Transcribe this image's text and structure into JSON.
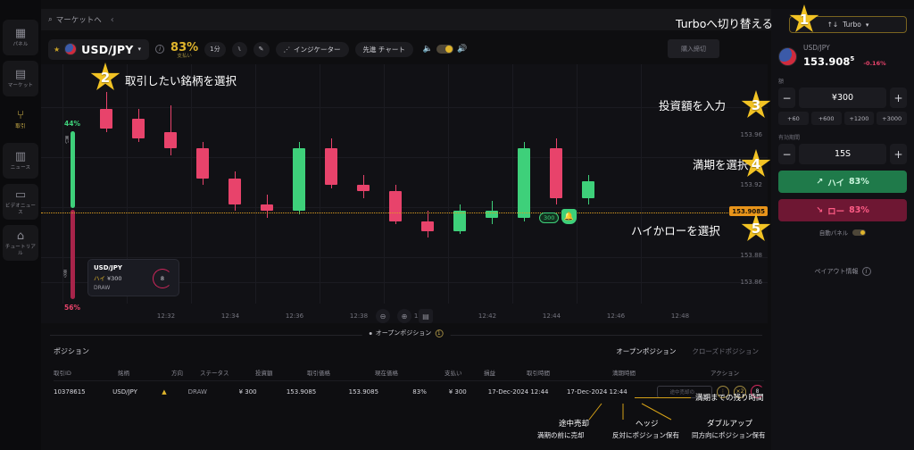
{
  "sidebar": {
    "items": [
      {
        "label": "パネル",
        "icon": "grid-icon",
        "active": false
      },
      {
        "label": "マーケット",
        "icon": "calendar-icon",
        "active": false
      },
      {
        "label": "取引",
        "icon": "trade-icon",
        "active": true
      },
      {
        "label": "ニュース",
        "icon": "news-icon",
        "active": false
      },
      {
        "label": "ビデオニュース",
        "icon": "video-icon",
        "active": false
      },
      {
        "label": "チュートリアル",
        "icon": "graduation-icon",
        "active": false
      }
    ]
  },
  "topbar": {
    "search_label": "マーケットへ",
    "search_icon": "search-icon",
    "back_icon": "chevron-left-icon"
  },
  "instrument_toolbar": {
    "star_icon": "star-icon",
    "flag_icon": "us-flag-icon",
    "name": "USD/JPY",
    "caret_icon": "chevron-down-icon",
    "info_icon": "info-icon",
    "payout_value": "83%",
    "payout_label": "支払い",
    "timeframe": "1分",
    "chart_type_icon": "candles-icon",
    "draw_icon": "pencil-icon",
    "indicators_label": "インジケーター",
    "indicators_icon": "indicator-icon",
    "advanced_chart_label": "先進 チャート",
    "sound_low_icon": "volume-low-icon",
    "sound_high_icon": "volume-high-icon",
    "buy_deadline_label": "購入締切"
  },
  "chart_data": {
    "type": "candlestick",
    "title": "USD/JPY",
    "timeframe": "1分",
    "xlabel": "",
    "ylabel": "",
    "ylim": [
      153.84,
      153.985
    ],
    "price_ticks": [
      "153.96",
      "153.92",
      "153.88",
      "153.86"
    ],
    "time_ticks": [
      "12:32",
      "12:34",
      "12:36",
      "12:38",
      "12:40",
      "12:42",
      "12:44",
      "12:46",
      "12:48"
    ],
    "current_price": "153.9085",
    "strike_price": "153.9085",
    "sentiment": {
      "up_pct": "44%",
      "down_pct": "56%",
      "up_label": "買い",
      "down_label": "売り"
    },
    "candles": [
      {
        "t": "12:31",
        "o": 153.958,
        "h": 153.968,
        "l": 153.944,
        "c": 153.946,
        "dir": "down"
      },
      {
        "t": "12:32",
        "o": 153.952,
        "h": 153.958,
        "l": 153.938,
        "c": 153.94,
        "dir": "down"
      },
      {
        "t": "12:33",
        "o": 153.944,
        "h": 153.96,
        "l": 153.93,
        "c": 153.934,
        "dir": "down"
      },
      {
        "t": "12:34",
        "o": 153.934,
        "h": 153.938,
        "l": 153.912,
        "c": 153.916,
        "dir": "down"
      },
      {
        "t": "12:35",
        "o": 153.916,
        "h": 153.92,
        "l": 153.896,
        "c": 153.9,
        "dir": "down"
      },
      {
        "t": "12:36",
        "o": 153.9,
        "h": 153.906,
        "l": 153.892,
        "c": 153.896,
        "dir": "down"
      },
      {
        "t": "12:37",
        "o": 153.896,
        "h": 153.938,
        "l": 153.894,
        "c": 153.934,
        "dir": "up"
      },
      {
        "t": "12:38",
        "o": 153.934,
        "h": 153.94,
        "l": 153.91,
        "c": 153.912,
        "dir": "down"
      },
      {
        "t": "12:39",
        "o": 153.912,
        "h": 153.918,
        "l": 153.904,
        "c": 153.908,
        "dir": "down"
      },
      {
        "t": "12:40",
        "o": 153.908,
        "h": 153.912,
        "l": 153.888,
        "c": 153.89,
        "dir": "down"
      },
      {
        "t": "12:41",
        "o": 153.89,
        "h": 153.896,
        "l": 153.88,
        "c": 153.884,
        "dir": "down"
      },
      {
        "t": "12:42",
        "o": 153.884,
        "h": 153.9,
        "l": 153.882,
        "c": 153.896,
        "dir": "up"
      },
      {
        "t": "12:43",
        "o": 153.896,
        "h": 153.902,
        "l": 153.888,
        "c": 153.892,
        "dir": "up"
      },
      {
        "t": "12:44",
        "o": 153.892,
        "h": 153.938,
        "l": 153.89,
        "c": 153.934,
        "dir": "up"
      },
      {
        "t": "12:45",
        "o": 153.934,
        "h": 153.94,
        "l": 153.9,
        "c": 153.904,
        "dir": "down"
      },
      {
        "t": "12:46",
        "o": 153.904,
        "h": 153.918,
        "l": 153.9,
        "c": 153.914,
        "dir": "up"
      }
    ],
    "marker": {
      "amount": "300",
      "icon": "alarm-icon"
    },
    "trade_card": {
      "instrument": "USD/JPY",
      "direction": "ハイ",
      "amount": "¥300",
      "status": "DRAW",
      "countdown": "8"
    },
    "controls": {
      "zoom_out_icon": "zoom-out-icon",
      "zoom_in_icon": "zoom-in-icon",
      "fit_icon": "fit-screen-icon"
    }
  },
  "right_panel": {
    "turbo_label": "Turbo",
    "turbo_icon": "up-down-arrows-icon",
    "turbo_caret_icon": "chevron-down-icon",
    "asset_name": "USD/JPY",
    "asset_price_main": "153.908",
    "asset_price_sup": "5",
    "asset_change": "-0.16%",
    "amount_label": "額",
    "amount_value": "¥300",
    "minus_label": "−",
    "plus_label": "+",
    "quick_amounts": [
      "+60",
      "+600",
      "+1200",
      "+3000"
    ],
    "expiry_label": "有効期間",
    "expiry_value": "15S",
    "high_arrow_icon": "arrow-up-right-icon",
    "high_label": "ハイ",
    "high_payout": "83%",
    "low_arrow_icon": "arrow-down-right-icon",
    "low_label": "ロー",
    "low_payout": "83%",
    "auto_panel_label": "自動パネル",
    "payout_info_label": "ペイアウト情報",
    "payout_info_icon": "info-icon"
  },
  "positions": {
    "open_pill_label": "オープンポジション",
    "open_pill_count": "1",
    "heading": "ポジション",
    "tabs": [
      {
        "label": "オープンポジション",
        "active": true
      },
      {
        "label": "クローズドポジション",
        "active": false
      }
    ],
    "columns": [
      "取引ID",
      "銘柄",
      "方向",
      "ステータス",
      "投資額",
      "取引価格",
      "現在価格",
      "支払い",
      "損益",
      "取引時間",
      "満期時間",
      "アクション"
    ],
    "rows": [
      {
        "id": "10378615",
        "symbol": "USD/JPY",
        "direction_icon": "triangle-up-icon",
        "status": "DRAW",
        "investment": "¥ 300",
        "trade_price": "153.9085",
        "current_price": "153.9085",
        "payout": "83%",
        "pnl": "¥ 300",
        "trade_time": "17-Dec-2024 12:44",
        "expiry_time": "17-Dec-2024 12:44",
        "sell_label": "途中売却の…",
        "hedge_icon": "hedge-icon",
        "double_icon": "double-up-icon",
        "countdown": "8"
      }
    ]
  },
  "annotations": {
    "step1": {
      "num": "1",
      "text": "Turboへ切り替える"
    },
    "step2": {
      "num": "2",
      "text": "取引したい銘柄を選択"
    },
    "step3": {
      "num": "3",
      "text": "投資額を入力"
    },
    "step4": {
      "num": "4",
      "text": "満期を選択"
    },
    "step5": {
      "num": "5",
      "text": "ハイかローを選択"
    },
    "remaining_time": "満期までの残り時間",
    "sell_title": "途中売却",
    "sell_sub": "満期の前に売却",
    "hedge_title": "ヘッジ",
    "hedge_sub": "反対にポジション保有",
    "double_title": "ダブルアップ",
    "double_sub": "同方向にポジション保有"
  }
}
